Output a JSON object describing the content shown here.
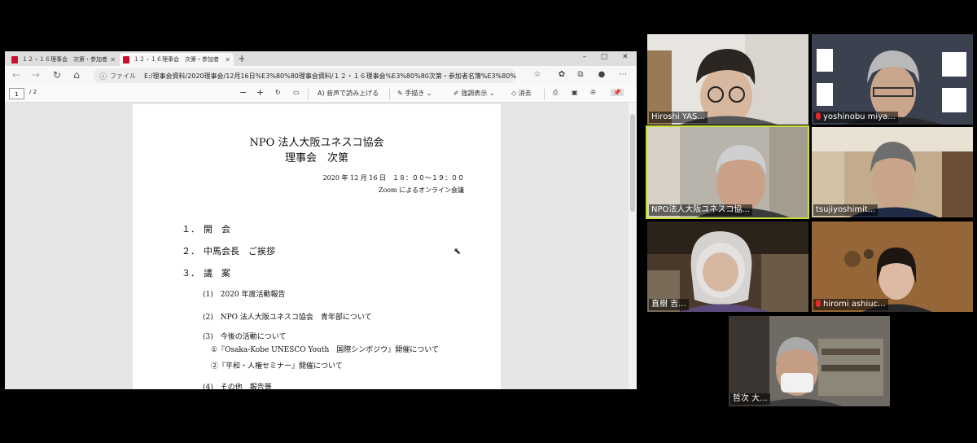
{
  "browser": {
    "tabs": [
      {
        "label": "１２・１６理事会　次第・参加者"
      },
      {
        "label": "１２・１６理事会　次第・参加者"
      }
    ],
    "new_tab": "+",
    "window": {
      "minimize": "–",
      "maximize": "▢",
      "close": "✕"
    },
    "address": {
      "file_label": "ファイル",
      "url": "E:/理事会資料/2020理事会/12月16日%E3%80%80理事会資料/１２・１６理事会%E3%80%80次第・参加者名簿%E3%80%8..."
    },
    "pdf_toolbar": {
      "page_current": "1",
      "page_total": "/ 2",
      "minus": "−",
      "plus": "+",
      "read_aloud": "音声で読み上げる",
      "draw": "手描き",
      "highlight": "強調表示",
      "erase": "消去"
    }
  },
  "document": {
    "title_line1": "NPO 法人大阪ユネスコ協会",
    "title_line2": "理事会　次第",
    "date": "2020 年 12 月 16 日　１８：００～１９：００",
    "venue": "Zoom によるオンライン会議",
    "items": [
      {
        "num": "１．",
        "text": "開　会"
      },
      {
        "num": "２．",
        "text": "中馬会長　ご挨拶"
      },
      {
        "num": "３．",
        "text": "議　案"
      }
    ],
    "sub_items": [
      "(1)　2020 年度活動報告",
      "(2)　NPO 法人大阪ユネスコ協会　青年部について",
      "(3)　今後の活動について",
      "①『Osaka-Kobe UNESCO Youth　国際シンポジウ』開催について",
      "②『平和・人権セミナー』開催について",
      "(4)　その他　報告等"
    ]
  },
  "participants": [
    {
      "name": "Hiroshi YAS...",
      "muted": false
    },
    {
      "name": "yoshinobu miya...",
      "muted": true
    },
    {
      "name": "NPO法人大阪ユネスコ協...",
      "muted": false
    },
    {
      "name": "tsujiyoshimit...",
      "muted": false
    },
    {
      "name": "直樹 吉...",
      "muted": false
    },
    {
      "name": "hiromi ashiuc...",
      "muted": true
    },
    {
      "name": "哲次 大...",
      "muted": false
    }
  ],
  "colors": {
    "active_speaker": "#c8e03a",
    "mic_muted": "#e02b2b",
    "pdf_icon": "#c8102e"
  }
}
